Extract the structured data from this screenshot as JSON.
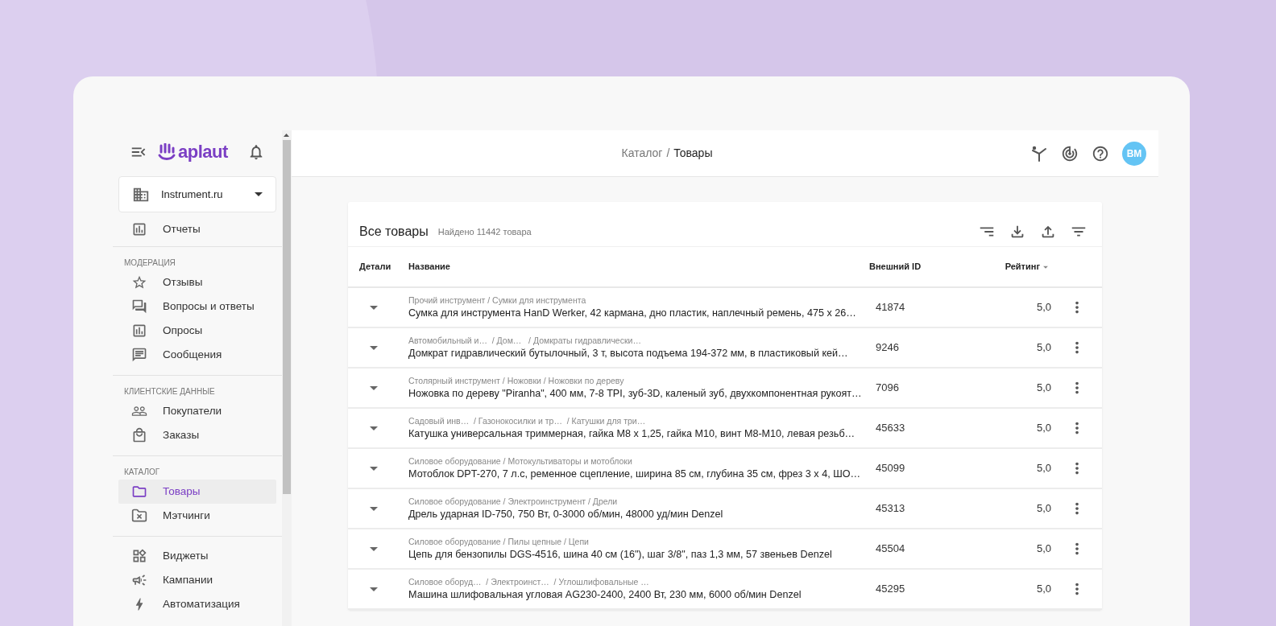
{
  "sidebar": {
    "logo": "aplaut",
    "company": "Instrument.ru",
    "sections": [
      {
        "items": [
          {
            "label": "Отчеты",
            "selected": false
          }
        ]
      },
      {
        "title": "МОДЕРАЦИЯ",
        "items": [
          {
            "label": "Отзывы",
            "selected": false
          },
          {
            "label": "Вопросы и ответы",
            "selected": false
          },
          {
            "label": "Опросы",
            "selected": false
          },
          {
            "label": "Сообщения",
            "selected": false
          }
        ]
      },
      {
        "title": "КЛИЕНТСКИЕ ДАННЫЕ",
        "items": [
          {
            "label": "Покупатели",
            "selected": false
          },
          {
            "label": "Заказы",
            "selected": false
          }
        ]
      },
      {
        "title": "КАТАЛОГ",
        "items": [
          {
            "label": "Товары",
            "selected": true
          },
          {
            "label": "Мэтчинги",
            "selected": false
          }
        ]
      },
      {
        "items": [
          {
            "label": "Виджеты",
            "selected": false
          },
          {
            "label": "Кампании",
            "selected": false
          },
          {
            "label": "Автоматизация",
            "selected": false
          }
        ]
      }
    ]
  },
  "header": {
    "breadcrumb": [
      "Каталог",
      "Товары"
    ],
    "separator": "/",
    "avatar": "ВМ"
  },
  "table": {
    "title": "Все товары",
    "count": "Найдено 11442 товара",
    "columns": [
      {
        "label": "Детали",
        "sorted": false
      },
      {
        "label": "Название",
        "sorted": false
      },
      {
        "label": "Внешний ID",
        "sorted": false
      },
      {
        "label": "Рейтинг",
        "sorted": true
      }
    ],
    "rows": [
      {
        "path": "Прочий инструмент / Сумки для инструмента",
        "name": "Сумка для инструмента HanD Werker, 42 кармана, дно пластик, наплечный ремень, 475 x 26…",
        "id": "41874",
        "rating": "5,0"
      },
      {
        "path": "Автомобильный и…  / Дом…   / Домкраты гидравлически…",
        "name": "Домкрат гидравлический бутылочный, 3 т, высота подъема 194-372 мм, в пластиковый кей…",
        "id": "9246",
        "rating": "5,0"
      },
      {
        "path": "Столярный инструмент / Ножовки / Ножовки по дереву",
        "name": "Ножовка по дереву \"Piranha\", 400 мм, 7-8 TPI, зуб-3D, каленый зуб, двухкомпонентная рукоят…",
        "id": "7096",
        "rating": "5,0"
      },
      {
        "path": "Садовый инв…  / Газонокосилки и тр…  / Катушки для три…",
        "name": "Катушка универсальная триммерная, гайка М8 x 1,25, гайка М10, винт М8-М10, левая резьб…",
        "id": "45633",
        "rating": "5,0"
      },
      {
        "path": "Силовое оборудование / Мотокультиваторы и мотоблоки",
        "name": "Мотоблок DPT-270, 7 л.с, ременное сцепление, ширина 85 см, глубина 35 см, фрез 3 x 4, ШО…",
        "id": "45099",
        "rating": "5,0"
      },
      {
        "path": "Силовое оборудование / Электроинструмент / Дрели",
        "name": "Дрель ударная ID-750, 750 Вт, 0-3000 об/мин, 48000 уд/мин Denzel",
        "id": "45313",
        "rating": "5,0"
      },
      {
        "path": "Силовое оборудование / Пилы цепные / Цепи",
        "name": "Цепь для бензопилы DGS-4516, шина 40 см (16\"), шаг 3/8\", паз 1,3 мм, 57 звеньев Denzel",
        "id": "45504",
        "rating": "5,0"
      },
      {
        "path": "Силовое оборуд…  / Электроинст…  / Углошлифовальные …",
        "name": "Машина шлифовальная угловая AG230-2400, 2400 Вт, 230 мм, 6000 об/мин Denzel",
        "id": "45295",
        "rating": "5,0"
      }
    ]
  }
}
